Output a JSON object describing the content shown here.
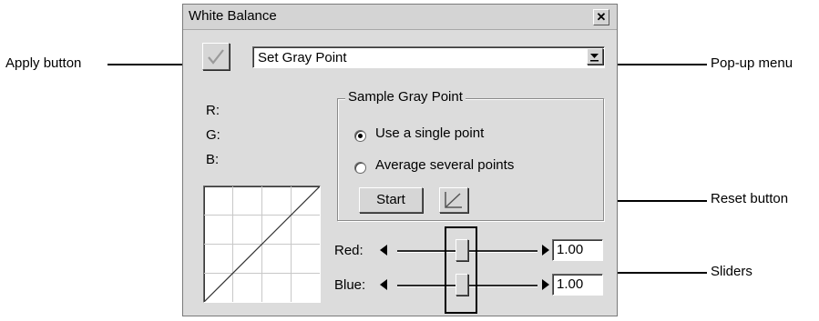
{
  "window": {
    "title": "White Balance",
    "close_glyph": "✕"
  },
  "apply_button": {
    "label": "",
    "icon": "check-icon"
  },
  "mode_menu": {
    "selected": "Set Gray Point"
  },
  "rgb": {
    "r": "R:",
    "g": "G:",
    "b": "B:"
  },
  "sample_group": {
    "title": "Sample Gray Point",
    "options": [
      {
        "label": "Use a single point",
        "checked": true
      },
      {
        "label": "Average several points",
        "checked": false
      }
    ],
    "start_label": "Start"
  },
  "sliders": [
    {
      "label": "Red:",
      "value": "1.00"
    },
    {
      "label": "Blue:",
      "value": "1.00"
    }
  ],
  "callouts": {
    "apply": "Apply button",
    "popup": "Pop-up menu",
    "reset": "Reset button",
    "sliders": "Sliders"
  }
}
